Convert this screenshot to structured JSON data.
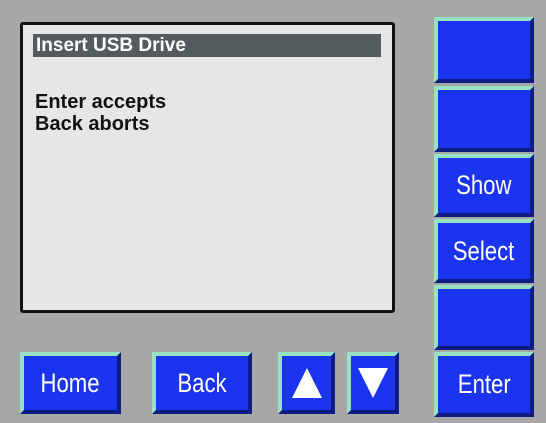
{
  "screen": {
    "title": "Insert USB Drive",
    "lines": [
      "Enter accepts",
      "Back aborts"
    ]
  },
  "side_buttons": {
    "show_label": "Show",
    "select_label": "Select",
    "enter_label": "Enter"
  },
  "bottom_buttons": {
    "home_label": "Home",
    "back_label": "Back",
    "up_icon": "up-arrow-icon",
    "down_icon": "down-arrow-icon"
  },
  "colors": {
    "button_blue": "#1b34ef",
    "button_highlight": "#97e2c4",
    "screen_background": "#e6e6e6",
    "title_bar": "#545b5e",
    "panel_background": "#a7a7a7"
  }
}
